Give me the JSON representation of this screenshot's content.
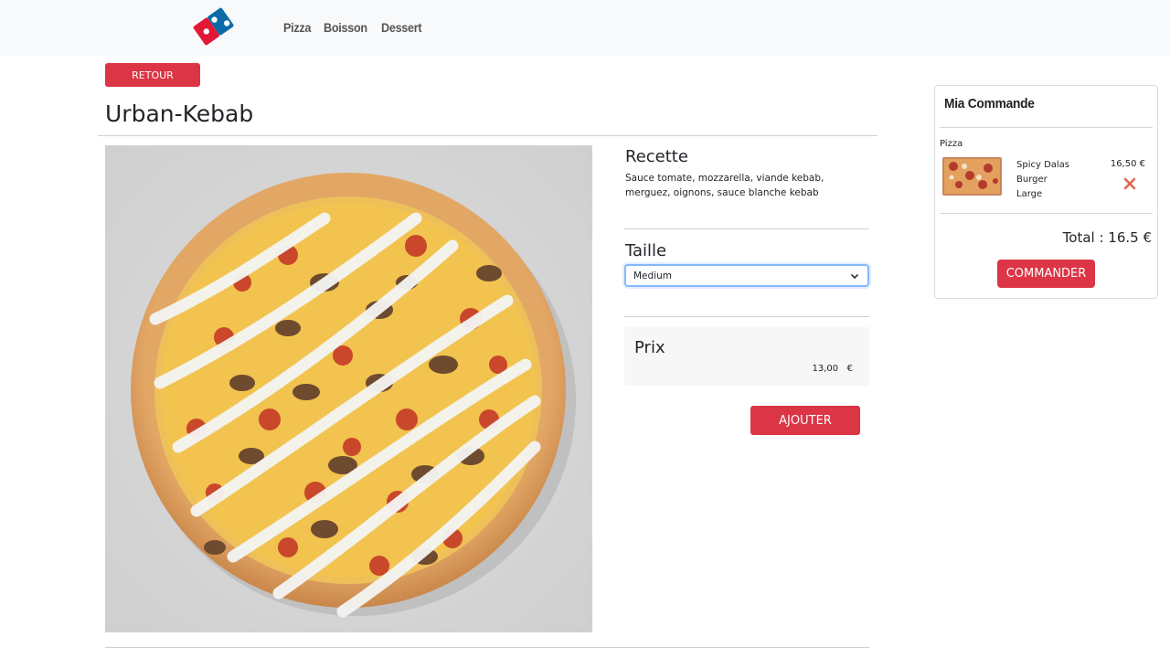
{
  "brand": {
    "logo_text": "Domino's Pizza"
  },
  "nav": {
    "items": [
      "Pizza",
      "Boisson",
      "Dessert"
    ]
  },
  "product": {
    "back_label": "RETOUR",
    "name": "Urban-Kebab",
    "recipe_title": "Recette",
    "recipe": "Sauce tomate, mozzarella, viande kebab, merguez, oignons, sauce blanche kebab",
    "size_title": "Taille",
    "size_selected": "Medium",
    "price_title": "Prix",
    "price": "13,00   €",
    "add_label": "AJOUTER"
  },
  "cart": {
    "title": "Mia Commande",
    "category": "Pizza",
    "item": {
      "name": "Spicy Dalas",
      "crust": "Burger",
      "size": "Large",
      "price": "16,50 €"
    },
    "total": "Total : 16.5 €",
    "order_label": "COMMANDER"
  },
  "colors": {
    "accent": "#dc3545",
    "navbar": "#f8f9fa",
    "logo_blue": "#0b6aa8",
    "logo_red": "#e31837"
  },
  "icons": {
    "remove": "close-icon",
    "select": "chevron-down-icon"
  }
}
